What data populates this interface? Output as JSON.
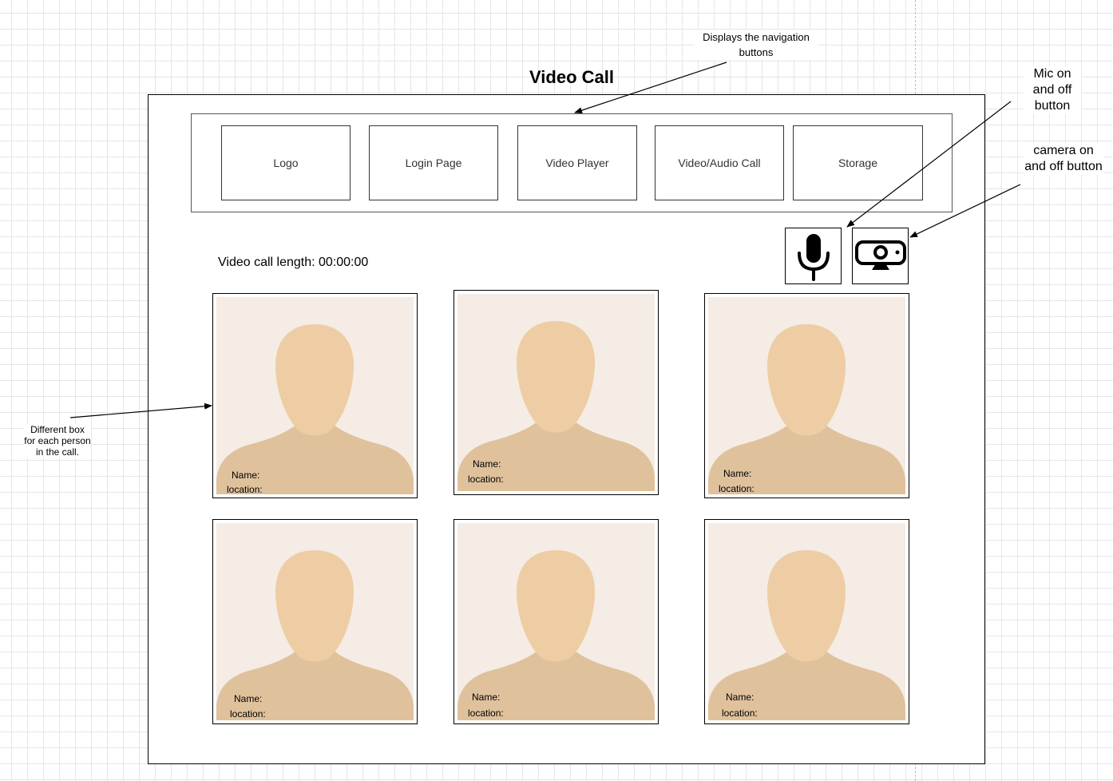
{
  "page_title": "Video Call",
  "nav_buttons": [
    {
      "label": "Logo"
    },
    {
      "label": "Login Page"
    },
    {
      "label": "Video Player"
    },
    {
      "label": "Video/Audio Call"
    },
    {
      "label": "Storage"
    }
  ],
  "call_length": "Video call length: 00:00:00",
  "annotations": {
    "nav": "Displays the navigation buttons",
    "mic": "Mic on and off button",
    "camera": "camera on and off button",
    "tiles": "Different box for each person in the call."
  },
  "controls": {
    "mic_icon": "microphone-icon",
    "camera_icon": "webcam-icon"
  },
  "participants": [
    {
      "name_label": "Name:",
      "location_label": "location:"
    },
    {
      "name_label": "Name:",
      "location_label": "location:"
    },
    {
      "name_label": "Name:",
      "location_label": "location:"
    },
    {
      "name_label": "Name:",
      "location_label": "location:"
    },
    {
      "name_label": "Name:",
      "location_label": "location:"
    },
    {
      "name_label": "Name:",
      "location_label": "location:"
    }
  ],
  "colors": {
    "avatar_background": "#f4ece5",
    "avatar_skin": "#eecda4",
    "avatar_shoulders": "#dfc19c"
  }
}
